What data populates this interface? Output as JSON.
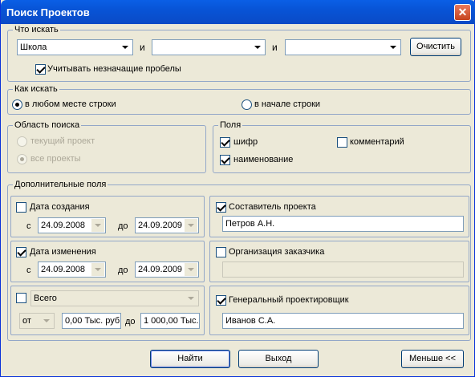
{
  "window": {
    "title": "Поиск Проектов",
    "close_glyph": "✕"
  },
  "what": {
    "legend": "Что искать",
    "combo1": "Школа",
    "combo2": "",
    "combo3": "",
    "and1": "и",
    "and2": "и",
    "clear_button": "Очистить",
    "ignore_spaces_label": "Учитывать незначащие пробелы"
  },
  "how": {
    "legend": "Как искать",
    "anywhere_label": "в любом месте строки",
    "start_label": "в начале строки"
  },
  "area": {
    "legend": "Область поиска",
    "current_label": "текущий проект",
    "all_label": "все проекты"
  },
  "fields": {
    "legend": "Поля",
    "code_label": "шифр",
    "comment_label": "комментарий",
    "name_label": "наименование"
  },
  "extra": {
    "legend": "Дополнительные поля",
    "created_label": "Дата создания",
    "created_from_label": "с",
    "created_from": "24.09.2008",
    "created_to_label": "до",
    "created_to": "24.09.2009",
    "author_label": "Составитель проекта",
    "author_value": "Петров А.Н.",
    "modified_label": "Дата изменения",
    "modified_from_label": "с",
    "modified_from": "24.09.2008",
    "modified_to_label": "до",
    "modified_to": "24.09.2009",
    "org_label": "Организация заказчика",
    "org_value": "",
    "total_combo": "Всего",
    "total_from_combo": "от",
    "total_min": "0,00 Тыс. руб",
    "total_to_label": "до",
    "total_max": "1 000,00 Тыс.",
    "general_label": "Генеральный проектировщик",
    "general_value": "Иванов С.А."
  },
  "buttons": {
    "find": "Найти",
    "exit": "Выход",
    "less": "Меньше <<"
  }
}
